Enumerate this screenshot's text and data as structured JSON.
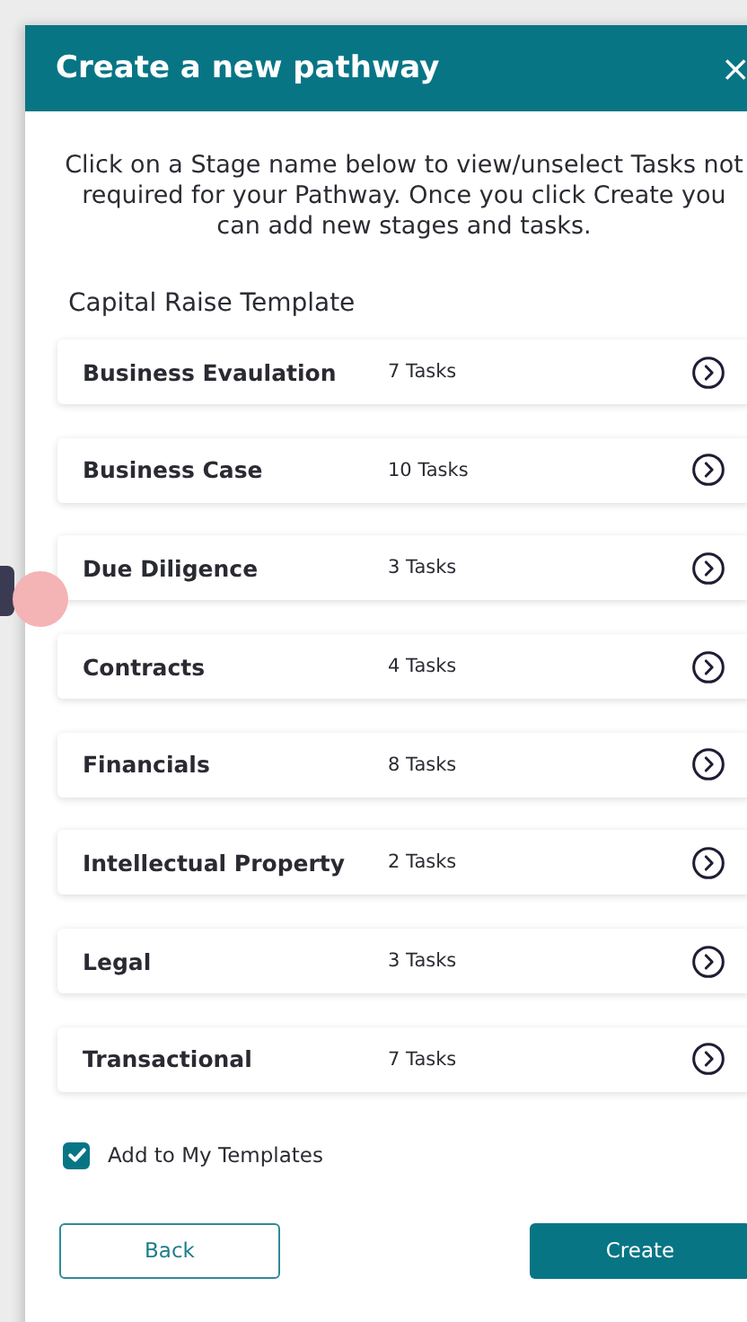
{
  "dialog": {
    "title": "Create a new pathway",
    "close": "×"
  },
  "instructions": "Click on a Stage name below to view/unselect Tasks not required for your Pathway. Once you click Create you can add new stages and tasks.",
  "template_name": "Capital Raise Template",
  "stages": [
    {
      "name": "Business Evaulation",
      "tasks": "7 Tasks"
    },
    {
      "name": "Business Case",
      "tasks": "10 Tasks"
    },
    {
      "name": "Due Diligence",
      "tasks": "3 Tasks"
    },
    {
      "name": "Contracts",
      "tasks": "4 Tasks"
    },
    {
      "name": "Financials",
      "tasks": "8 Tasks"
    },
    {
      "name": "Intellectual Property",
      "tasks": "2 Tasks"
    },
    {
      "name": "Legal",
      "tasks": "3 Tasks"
    },
    {
      "name": "Transactional",
      "tasks": "7 Tasks"
    }
  ],
  "add_to_templates": {
    "label": "Add to My Templates",
    "checked": true
  },
  "buttons": {
    "back": "Back",
    "create": "Create"
  }
}
